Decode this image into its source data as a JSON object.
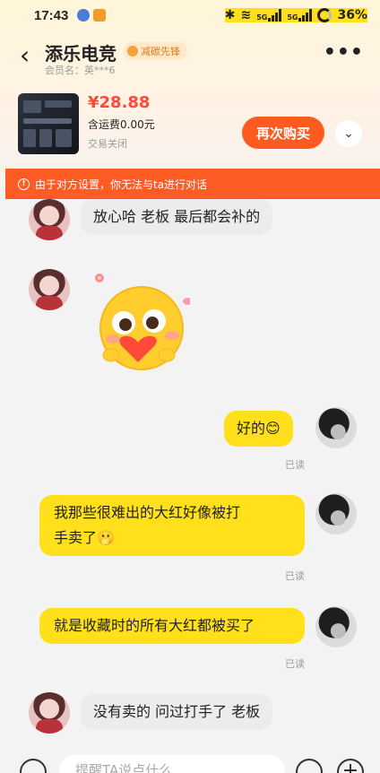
{
  "status_bar": {
    "time": "17:43",
    "network_labels": [
      "5G",
      "5G"
    ],
    "battery": "36%"
  },
  "header": {
    "shop_name": "添乐电竞",
    "badge": "减碳先锋",
    "member": "会员名：英***6",
    "more_glyph": "•••",
    "back_glyph": "‹"
  },
  "product": {
    "price": "¥28.88",
    "shipping": "含运费0.00元",
    "deal_status": "交易关闭",
    "rebuy_label": "再次购买",
    "expand_glyph": "⌄"
  },
  "warning": {
    "icon_glyph": "!",
    "text": "由于对方设置，你无法与ta进行对话"
  },
  "messages": [
    {
      "side": "left",
      "text": "放心哈 老板 最后都会补的"
    },
    {
      "side": "left",
      "type": "emoji-sticker",
      "icon": "blushing-heart-emoji-icon"
    },
    {
      "side": "right",
      "text": "好的😊",
      "read": "已读"
    },
    {
      "side": "right",
      "text_line1": "我那些很难出的大红好像被打",
      "text_line2": "手卖了🫢",
      "read": "已读"
    },
    {
      "side": "right",
      "text": "就是收藏时的所有大红都被买了",
      "read": "已读"
    },
    {
      "side": "left",
      "text": "没有卖的 问过打手了 老板"
    }
  ],
  "input_bar": {
    "placeholder": "提醒TA说点什么"
  },
  "colors": {
    "accent": "#ff5a1f",
    "warning_bg": "#ff5b24",
    "bubble_right": "#ffe01a",
    "bubble_left": "#ececec",
    "price": "#ff4a3a"
  }
}
